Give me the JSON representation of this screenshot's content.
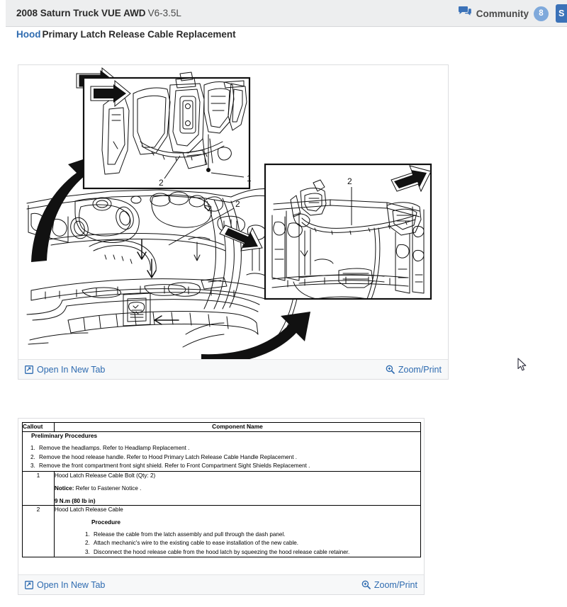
{
  "header": {
    "vehicle": "2008 Saturn Truck VUE AWD",
    "engine": "V6-3.5L",
    "community_label": "Community",
    "community_count": "8",
    "save_label": "S",
    "community_icon": "speech-bubble-icon"
  },
  "subtitle": {
    "link": "Hood",
    "rest": "Primary Latch Release Cable Replacement"
  },
  "figure_card": {
    "open_new_tab": "Open In New Tab",
    "zoom_print": "Zoom/Print",
    "callouts": [
      "1",
      "2",
      "2",
      "2"
    ]
  },
  "table_card": {
    "open_new_tab": "Open In New Tab",
    "zoom_print": "Zoom/Print"
  },
  "service_table": {
    "headers": {
      "callout": "Callout",
      "component": "Component Name"
    },
    "prelim": {
      "heading": "Preliminary Procedures",
      "steps": [
        "Remove the headlamps. Refer to Headlamp Replacement .",
        "Remove the hood release handle. Refer to Hood Primary Latch Release Cable Handle Replacement .",
        "Remove the front compartment front sight shield. Refer to Front Compartment Sight Shields Replacement ."
      ]
    },
    "rows": [
      {
        "callout": "1",
        "name": "Hood Latch Release Cable Bolt (Qty: 2)",
        "notice_label": "Notice:",
        "notice_text": "Refer to Fastener Notice .",
        "torque": "9 N.m (80 lb in)"
      },
      {
        "callout": "2",
        "name": "Hood Latch Release Cable",
        "procedure_heading": "Procedure",
        "steps": [
          "Release the cable from the latch assembly and pull through the dash panel.",
          "Attach mechanic's wire to the existing cable to ease installation of the new cable.",
          "Disconnect the hood release cable from the hood latch by squeezing the hood release cable retainer."
        ]
      }
    ]
  },
  "colors": {
    "link": "#2e6bb0",
    "header_bg": "#edeeef",
    "badge": "#7fa9db",
    "accent_button": "#3b72b8"
  }
}
